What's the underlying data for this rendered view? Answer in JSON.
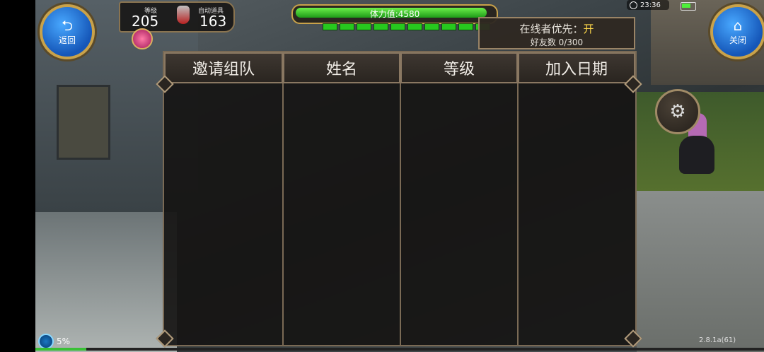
{
  "player": {
    "level_label": "等级",
    "level_value": "205",
    "auto_potion_label": "自动道具",
    "auto_potion_value": "163"
  },
  "stamina": {
    "label": "体力值:4580",
    "fill_fraction": 0.98,
    "segments_filled": 10
  },
  "buttons": {
    "back_label": "返回",
    "close_label": "关闭"
  },
  "online_priority": {
    "label": "在线者优先：",
    "state": "开",
    "friend_count": "好友数 0/300"
  },
  "table": {
    "columns": [
      "邀请组队",
      "姓名",
      "等级",
      "加入日期"
    ],
    "rows": []
  },
  "status_bar": {
    "time": "23:36",
    "battery_fraction": 0.65
  },
  "bottom": {
    "loading_percent": "5%",
    "version": "2.8.1a(61)",
    "xp_fraction": 0.07
  },
  "icons": {
    "back": "return-arrow-icon",
    "close": "home-icon",
    "settings": "gear-icon",
    "gift": "gift-icon",
    "potion": "potion-icon"
  },
  "colors": {
    "accent_gold": "#c9a24a",
    "stamina_green": "#27c81e",
    "on_yellow": "#ffd84a"
  }
}
